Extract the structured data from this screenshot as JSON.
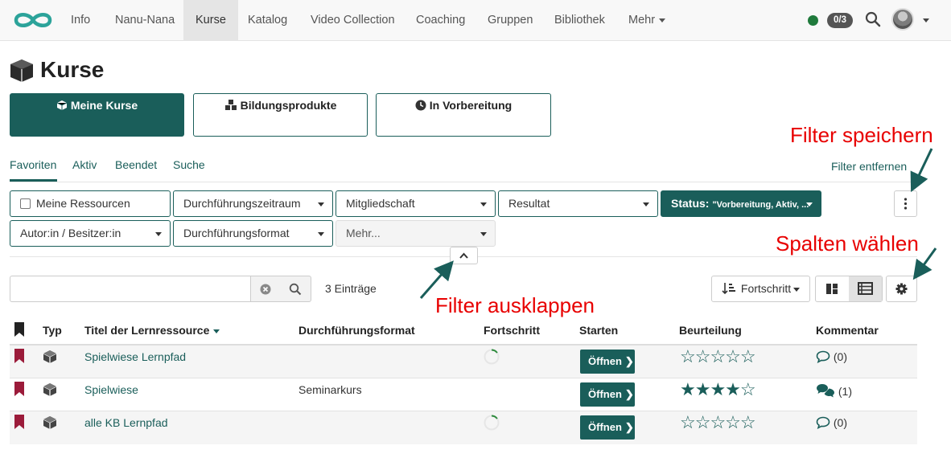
{
  "nav": {
    "items": [
      "Info",
      "Nanu-Nana",
      "Kurse",
      "Katalog",
      "Video Collection",
      "Coaching",
      "Gruppen",
      "Bibliothek",
      "Mehr"
    ],
    "active": "Kurse",
    "badge": "0/3",
    "online_color": "#1f7a3c"
  },
  "page": {
    "title": "Kurse"
  },
  "cards": [
    {
      "label": "Meine Kurse",
      "icon": "cube-icon"
    },
    {
      "label": "Bildungsprodukte",
      "icon": "cubes-icon"
    },
    {
      "label": "In Vorbereitung",
      "icon": "clock-icon"
    }
  ],
  "subtabs": [
    "Favoriten",
    "Aktiv",
    "Beendet",
    "Suche"
  ],
  "filter_remove": "Filter entfernen",
  "filters": {
    "row1": [
      "Meine Ressourcen",
      "Durchführungszeitraum",
      "Mitgliedschaft",
      "Resultat"
    ],
    "status_label": "Status:",
    "status_value": "\"Vorbereitung, Aktiv, ...",
    "row2": [
      "Autor:in / Besitzer:in",
      "Durchführungsformat",
      "Mehr..."
    ]
  },
  "search": {
    "value": "",
    "entries": "3 Einträge"
  },
  "sort": {
    "label": "Fortschritt"
  },
  "table": {
    "headers": [
      "Typ",
      "Titel der Lernressource",
      "Durchführungsformat",
      "Fortschritt",
      "Starten",
      "Beurteilung",
      "Kommentar"
    ],
    "rows": [
      {
        "title": "Spielwiese Lernpfad",
        "format": "",
        "progress": 0.15,
        "action": "Öffnen",
        "rating": 0,
        "rating_max": 5,
        "comments": "(0)"
      },
      {
        "title": "Spielwiese",
        "format": "Seminarkurs",
        "progress": null,
        "action": "Öffnen",
        "rating": 4,
        "rating_max": 5,
        "comments": "(1)"
      },
      {
        "title": "alle KB Lernpfad",
        "format": "",
        "progress": 0.15,
        "action": "Öffnen",
        "rating": 0,
        "rating_max": 5,
        "comments": "(0)"
      }
    ]
  },
  "annotations": {
    "save_filter": "Filter speichern",
    "choose_columns": "Spalten wählen",
    "expand_filter": "Filter ausklappen"
  },
  "colors": {
    "accent": "#1a5e5a",
    "bookmark": "#9b1b3a",
    "annotation": "#e80000"
  }
}
